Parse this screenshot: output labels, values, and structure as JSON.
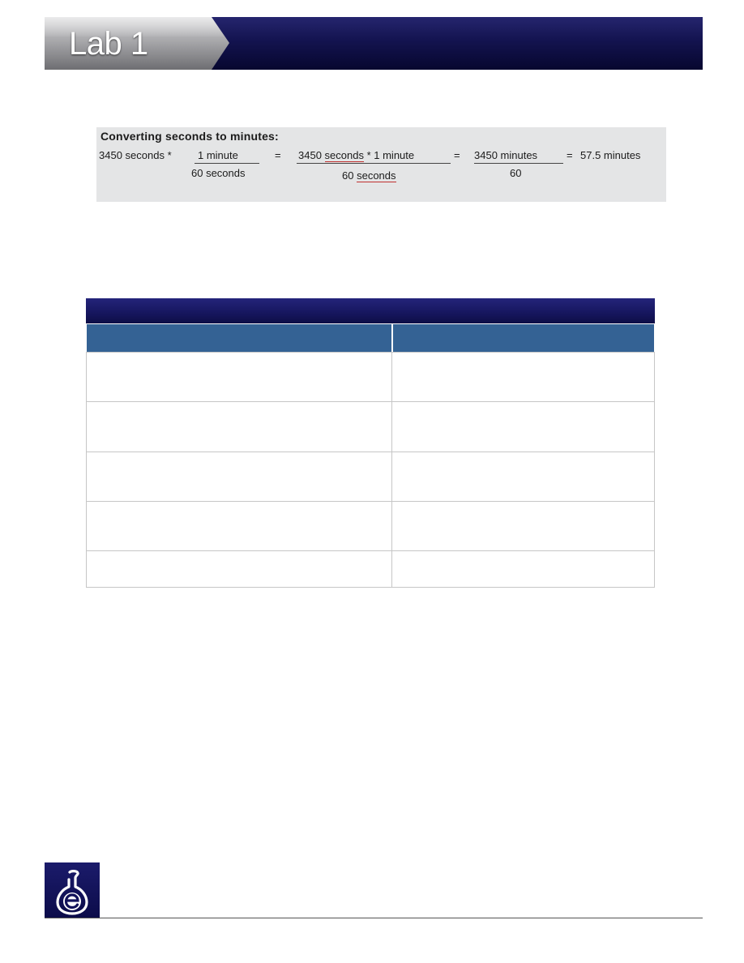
{
  "header": {
    "title": "Lab 1"
  },
  "example": {
    "title": "Converting seconds to minutes:",
    "term1": "3450 seconds *",
    "frac1_num": "1 minute",
    "frac1_den": "60 seconds",
    "eq1": "=",
    "frac2_num_a": "3450",
    "frac2_num_b": "seconds",
    "frac2_num_c": "* 1 minute",
    "frac2_den_a": "60",
    "frac2_den_b": "seconds",
    "eq2": "=",
    "frac3_num": "3450 minutes",
    "frac3_den": "60",
    "eq3": "=",
    "result": "57.5 minutes"
  },
  "table": {
    "title": "",
    "columns": [
      "",
      ""
    ],
    "rows": [
      [
        "",
        ""
      ],
      [
        "",
        ""
      ],
      [
        "",
        ""
      ],
      [
        "",
        ""
      ],
      [
        "",
        ""
      ]
    ]
  },
  "footer": {
    "logo": "flask-e-logo-icon"
  }
}
